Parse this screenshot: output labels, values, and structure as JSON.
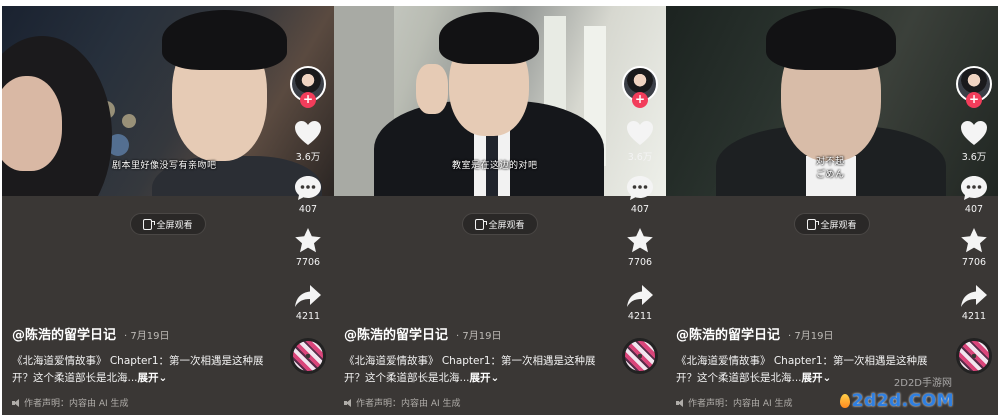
{
  "panels": [
    {
      "subtitle": [
        "剧本里好像没写有亲吻吧"
      ],
      "fullscreen_label": "全屏观看",
      "likes": "3.6万",
      "comments": "407",
      "favorites": "7706",
      "shares": "4211",
      "author": "@陈浩的留学日记",
      "date": "· 7月19日",
      "description": "《北海道爱情故事》 Chapter1：第一次相遇是这种展开？这个柔道部长是北海...",
      "expand_label": "展开",
      "disclaimer": "作者声明：内容由 AI 生成"
    },
    {
      "subtitle": [
        "教室是在这边的对吧"
      ],
      "fullscreen_label": "全屏观看",
      "likes": "3.6万",
      "comments": "407",
      "favorites": "7706",
      "shares": "4211",
      "author": "@陈浩的留学日记",
      "date": "· 7月19日",
      "description": "《北海道爱情故事》 Chapter1：第一次相遇是这种展开？这个柔道部长是北海...",
      "expand_label": "展开",
      "disclaimer": "作者声明：内容由 AI 生成"
    },
    {
      "subtitle": [
        "对不起",
        "ごめん"
      ],
      "fullscreen_label": "全屏观看",
      "likes": "3.6万",
      "comments": "407",
      "favorites": "7706",
      "shares": "4211",
      "author": "@陈浩的留学日记",
      "date": "· 7月19日",
      "description": "《北海道爱情故事》 Chapter1：第一次相遇是这种展开？这个柔道部长是北海...",
      "expand_label": "展开",
      "disclaimer": "作者声明：内容由 AI 生成"
    }
  ],
  "watermark": {
    "small": "2D2D手游网",
    "big": "2d2d.COM"
  },
  "colors": {
    "panel_bg": "#3a3735",
    "follow_accent": "#f23d5b",
    "watermark_blue": "#2f7fe0"
  },
  "icons": [
    "avatar",
    "plus-icon",
    "heart-icon",
    "comment-icon",
    "star-icon",
    "share-icon",
    "music-disc-icon",
    "fullscreen-icon",
    "speaker-icon"
  ]
}
